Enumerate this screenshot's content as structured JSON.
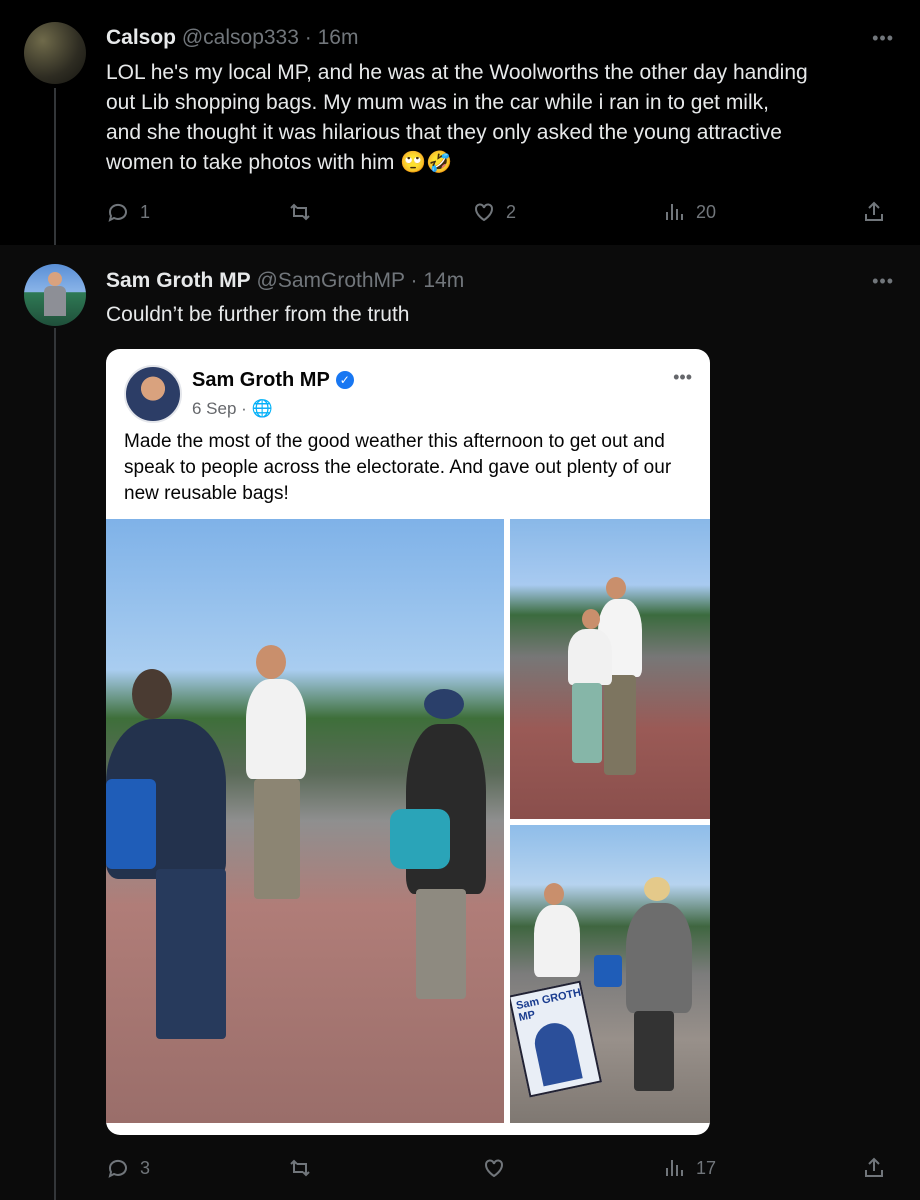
{
  "tweets": [
    {
      "name": "Calsop",
      "handle": "@calsop333",
      "time": "16m",
      "text_lines": [
        "LOL he's my local MP, and he was at the Woolworths the other day handing",
        "out Lib shopping bags. My mum was in the car while i ran in to get milk,",
        "and she thought it was hilarious that they only asked the young attractive",
        "women to take photos with him 🙄🤣"
      ],
      "replies": "1",
      "retweets": "",
      "likes": "2",
      "views": "20"
    },
    {
      "name": "Sam Groth MP",
      "handle": "@SamGrothMP",
      "time": "14m",
      "text": "Couldn’t be further from the truth",
      "replies": "3",
      "retweets": "",
      "likes": "",
      "views": "17"
    }
  ],
  "embed": {
    "name": "Sam Groth MP",
    "date": "6 Sep",
    "text": "Made the most of the good weather this afternoon to get out and speak to people across the electorate. And gave out plenty of our new reusable bags!",
    "poster_text": "Sam GROTH MP"
  },
  "icons": {
    "more": "more-horizontal-icon",
    "reply": "reply-icon",
    "retweet": "retweet-icon",
    "like": "heart-icon",
    "views": "views-icon",
    "share": "share-icon",
    "verified": "verified-badge-icon",
    "globe": "globe-icon"
  },
  "colors": {
    "background": "#000000",
    "text": "#e7e9ea",
    "muted": "#71767b",
    "fb_blue": "#1877f2"
  }
}
